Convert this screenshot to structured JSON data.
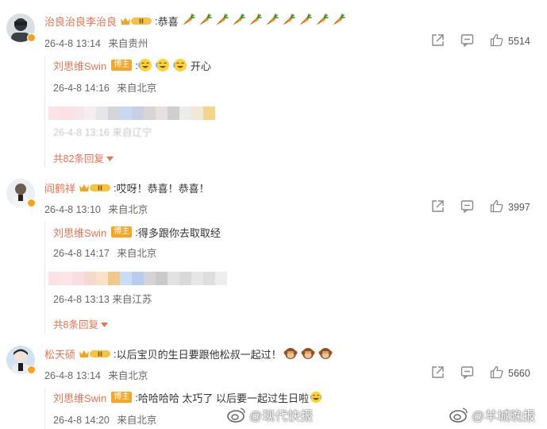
{
  "comments": [
    {
      "username": "治良治良李治良",
      "vip_level": "II",
      "colon": ":",
      "text": "恭喜",
      "emoji": "carrot",
      "emoji_count": 10,
      "date": "26-4-8 13:14",
      "location": "来自贵州",
      "likes": "5514",
      "reply": {
        "username": "刘思维Swin",
        "owner_tag": "博主",
        "text_suffix": "开心",
        "date": "26-4-8 14:16",
        "location": "来自北京",
        "hidden_meta": "26-4-8 13:16 来自辽宁",
        "more": "共82条回复"
      }
    },
    {
      "username": "阎鹤祥",
      "vip_level": "II",
      "colon": ":",
      "text": "哎呀！恭喜！恭喜！",
      "date": "26-4-8 13:10",
      "location": "来自北京",
      "likes": "3997",
      "reply": {
        "username": "刘思维Swin",
        "owner_tag": "博主",
        "text": "得多跟你去取取经",
        "date": "26-4-8 14:17",
        "location": "来自北京",
        "hidden_meta": "26-4-8 13:13 来自江苏",
        "more": "共8条回复"
      }
    },
    {
      "username": "松天硕",
      "vip_level": "II",
      "colon": ":",
      "text": "以后宝贝的生日要跟他松叔一起过！",
      "date": "26-4-8 13:14",
      "location": "来自北京",
      "likes": "5660",
      "reply": {
        "username": "刘思维Swin",
        "owner_tag": "博主",
        "text": "哈哈哈哈 太巧了 以后要一起过生日啦",
        "date": "26-4-8 14:20",
        "location": "来自北京"
      }
    }
  ],
  "watermarks": [
    "@现代快报",
    "@羊城晚报"
  ],
  "colors": {
    "username": "#eb7350",
    "meta": "#666666",
    "owner_tag": "#f5a623",
    "icon": "#888888"
  }
}
